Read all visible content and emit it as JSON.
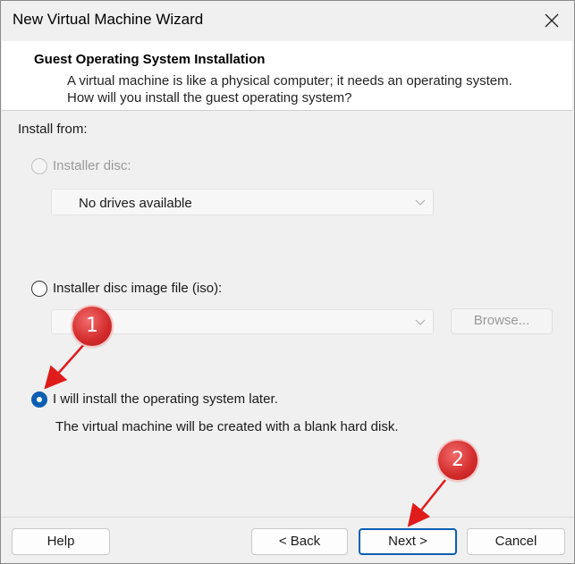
{
  "window": {
    "title": "New Virtual Machine Wizard"
  },
  "header": {
    "title": "Guest Operating System Installation",
    "description": "A virtual machine is like a physical computer; it needs an operating system. How will you install the guest operating system?"
  },
  "install_from": {
    "label": "Install from:",
    "options": [
      {
        "label": "Installer disc:",
        "selected": false,
        "enabled": false
      },
      {
        "label": "Installer disc image file (iso):",
        "selected": false,
        "enabled": true
      },
      {
        "label": "I will install the operating system later.",
        "selected": true,
        "enabled": true
      }
    ],
    "disc_drive": {
      "value": "No drives available"
    },
    "iso_path": {
      "value": ""
    },
    "browse_label": "Browse...",
    "later_note": "The virtual machine will be created with a blank hard disk."
  },
  "buttons": {
    "help": "Help",
    "back": "< Back",
    "next": "Next >",
    "cancel": "Cancel"
  },
  "annotations": [
    {
      "number": "1"
    },
    {
      "number": "2"
    }
  ],
  "colors": {
    "accent": "#0a5fb4",
    "annotation_red": "#d22a2a"
  },
  "icons": {
    "close": "close-icon",
    "dropdown": "chevron-down-icon"
  }
}
